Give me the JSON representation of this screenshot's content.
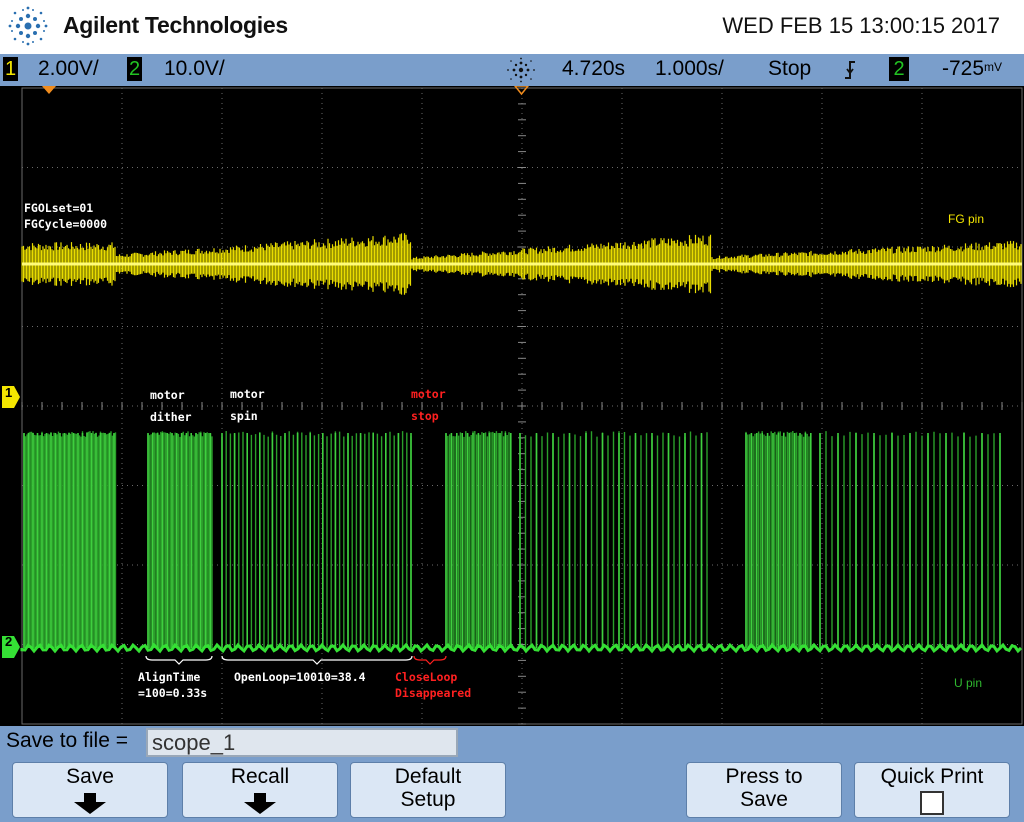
{
  "header": {
    "brand": "Agilent Technologies",
    "datetime": "WED FEB 15 13:00:15 2017",
    "logo_icon": "agilent-spark-icon"
  },
  "status_bar": {
    "ch1": {
      "number": "1",
      "scale": "2.00V/",
      "color": "#f4e600"
    },
    "ch2": {
      "number": "2",
      "scale": "10.0V/",
      "color": "#22c322"
    },
    "run_icon": "acquisition-spark-icon",
    "delay": "4.720s",
    "timebase": "1.000s/",
    "run_state": "Stop",
    "trigger_edge_icon": "falling-edge-icon",
    "trigger_source": "2",
    "trigger_level": "-725",
    "trigger_level_unit": "mV"
  },
  "waveform": {
    "ch1_marker": "1",
    "ch2_marker": "2",
    "labels": {
      "fg_olset": "FGOLset=01",
      "fg_cycle": "FGCycle=0000",
      "fg_pin": "FG pin",
      "u_pin": "U pin",
      "motor_dither_1": "motor",
      "motor_dither_2": "dither",
      "motor_spin_1": "motor",
      "motor_spin_2": "spin",
      "motor_stop_1": "motor",
      "motor_stop_2": "stop",
      "align_time_1": "AlignTime",
      "align_time_2": "=100=0.33s",
      "open_loop": "OpenLoop=10010=38.4",
      "close_loop_1": "CloseLoop",
      "close_loop_2": "Disappeared"
    },
    "colors": {
      "ch1": "#f4e600",
      "ch2": "#2fb82f",
      "ch2_bright": "#35e035",
      "white_text": "#ffffff",
      "red_text": "#ff2020"
    }
  },
  "save_panel": {
    "label": "Save to file =",
    "filename": "scope_1"
  },
  "softkeys": [
    {
      "line1": "Save",
      "line2": "",
      "icon": "down-arrow-icon"
    },
    {
      "line1": "Recall",
      "line2": "",
      "icon": "down-arrow-icon"
    },
    {
      "line1": "Default",
      "line2": "Setup",
      "icon": ""
    },
    {
      "line1": "Press to",
      "line2": "Save",
      "icon": ""
    },
    {
      "line1": "Quick Print",
      "line2": "",
      "icon": "checkbox-icon"
    }
  ]
}
